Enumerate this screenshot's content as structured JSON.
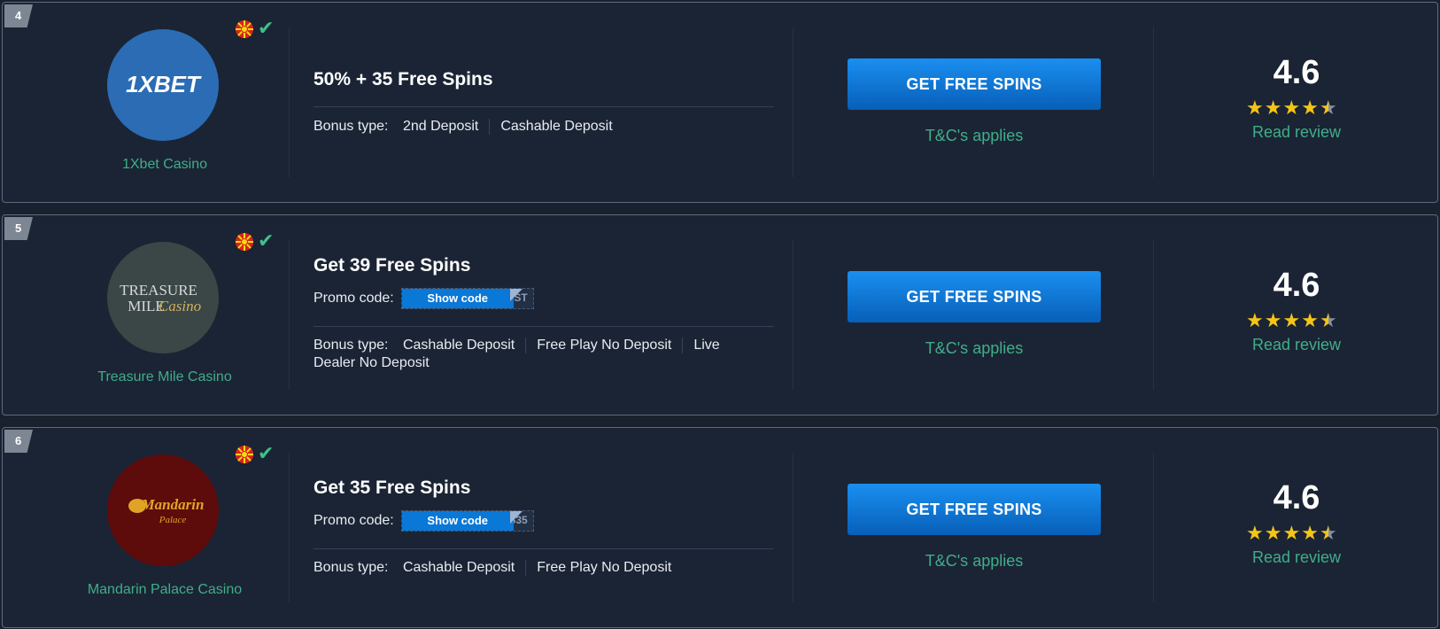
{
  "cards": [
    {
      "rank": "4",
      "casino_name": "1Xbet Casino",
      "logo_text": "1XBET",
      "logo_colors": {
        "bg": "#2b6cb5",
        "text": "#ffffff"
      },
      "bonus_title": "50% + 35 Free Spins",
      "bonus_type_label": "Bonus type:",
      "bonus_types": [
        "2nd Deposit",
        "Cashable Deposit"
      ],
      "cta_label": "GET FREE SPINS",
      "tc_label": "T&C's applies",
      "rating": "4.6",
      "stars": 4.6,
      "review_label": "Read review"
    },
    {
      "rank": "5",
      "casino_name": "Treasure Mile Casino",
      "logo_text": "TREASURE MILE",
      "logo_script": "Casino",
      "logo_colors": {
        "bg": "#3a4746",
        "text": "#d8d8d8"
      },
      "bonus_title": "Get 39 Free Spins",
      "promo_label": "Promo code:",
      "show_code_label": "Show code",
      "promo_tail": "ST",
      "bonus_type_label": "Bonus type:",
      "bonus_types_line1": [
        "Cashable Deposit",
        "Free Play No Deposit",
        "Live"
      ],
      "bonus_types_line2": "Dealer No Deposit",
      "cta_label": "GET FREE SPINS",
      "tc_label": "T&C's applies",
      "rating": "4.6",
      "stars": 4.6,
      "review_label": "Read review"
    },
    {
      "rank": "6",
      "casino_name": "Mandarin Palace Casino",
      "logo_text": "Mandarin",
      "logo_sub": "Palace",
      "logo_colors": {
        "bg": "#5e0b0b",
        "text": "#e0a425"
      },
      "bonus_title": "Get 35 Free Spins",
      "promo_label": "Promo code:",
      "show_code_label": "Show code",
      "promo_tail": "S35",
      "bonus_type_label": "Bonus type:",
      "bonus_types": [
        "Cashable Deposit",
        "Free Play No Deposit"
      ],
      "cta_label": "GET FREE SPINS",
      "tc_label": "T&C's applies",
      "rating": "4.6",
      "stars": 4.6,
      "review_label": "Read review"
    }
  ],
  "colors": {
    "accent_green": "#3fae8a",
    "button_blue": "#0a78d6",
    "star_yellow": "#f5c518"
  }
}
